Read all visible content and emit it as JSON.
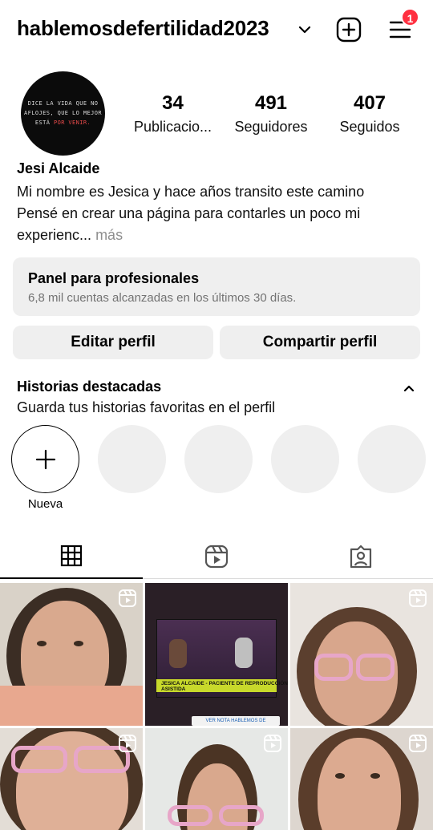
{
  "header": {
    "username": "hablemosdefertilidad2023",
    "notification_count": "1"
  },
  "profile": {
    "avatar_lines": [
      "DICE LA VIDA QUE NO",
      "AFLOJES, QUE LO MEJOR",
      "ESTÁ",
      "POR VENIR."
    ],
    "stats": [
      {
        "value": "34",
        "label": "Publicacio..."
      },
      {
        "value": "491",
        "label": "Seguidores"
      },
      {
        "value": "407",
        "label": "Seguidos"
      }
    ],
    "name": "Jesi Alcaide",
    "bio_line1": "Mi nombre es Jesica y hace años transito este camino",
    "bio_line2": "Pensé en crear una página para contarles un poco mi",
    "bio_line3": "experienc...",
    "bio_more": " más"
  },
  "panel": {
    "title": "Panel para profesionales",
    "subtitle": "6,8 mil cuentas alcanzadas en los últimos 30 días."
  },
  "buttons": {
    "edit": "Editar perfil",
    "share": "Compartir perfil"
  },
  "highlights": {
    "title": "Historias destacadas",
    "subtitle": "Guarda tus historias favoritas en el perfil",
    "new_label": "Nueva"
  },
  "post_news": {
    "banner": "JESICA ALCAIDE - PACIENTE DE REPRODUCCIÓN ASISTIDA",
    "link": "VER NOTA HABLEMOS DE FERTILIDAD"
  },
  "colors": {
    "badge": "#ff3040",
    "panel_bg": "#efefef",
    "muted_text": "#737373",
    "glasses": "#e7a6c8"
  },
  "icons": {
    "add": "plus-square-icon",
    "menu": "hamburger-menu-icon",
    "grid_tab": "grid-icon",
    "reels_tab": "reels-icon",
    "tagged_tab": "tagged-person-icon",
    "reel_indicator": "reel-icon"
  }
}
